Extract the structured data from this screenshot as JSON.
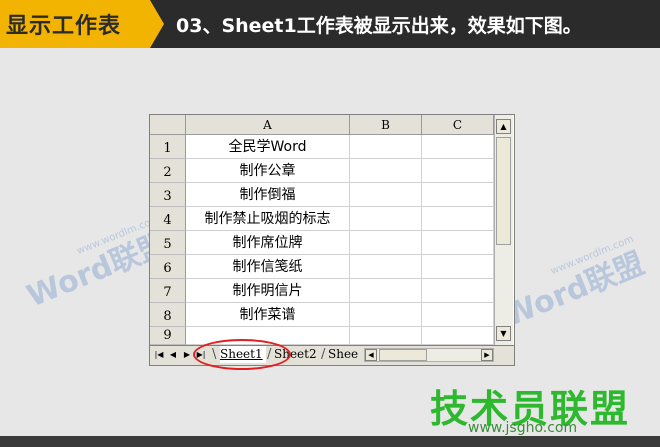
{
  "banner": {
    "badge": "显示工作表",
    "title": "03、Sheet1工作表被显示出来，效果如下图。",
    "badge_color": "#f2b400",
    "bg_color": "#2b2b2b"
  },
  "sheet": {
    "columns": [
      "A",
      "B",
      "C"
    ],
    "rows": [
      {
        "num": "1",
        "a": "全民学Word"
      },
      {
        "num": "2",
        "a": "制作公章"
      },
      {
        "num": "3",
        "a": "制作倒福"
      },
      {
        "num": "4",
        "a": "制作禁止吸烟的标志"
      },
      {
        "num": "5",
        "a": "制作席位牌"
      },
      {
        "num": "6",
        "a": "制作信笺纸"
      },
      {
        "num": "7",
        "a": "制作明信片"
      },
      {
        "num": "8",
        "a": "制作菜谱"
      },
      {
        "num": "9",
        "a": ""
      }
    ],
    "tabs": {
      "sheet1": "Sheet1",
      "sheet2": "Sheet2",
      "sheet3": "Shee"
    },
    "nav": {
      "first": "|◀",
      "prev": "◀",
      "next": "▶",
      "last": "▶|"
    }
  },
  "highlight_color": "#e02020",
  "watermark": {
    "left": "Word联盟",
    "left_small": "www.wordlm.com",
    "right": "Word联盟",
    "right_small": "www.wordlm.com"
  },
  "logo": {
    "name": "技术员联盟",
    "url": "www.jsgho.com",
    "color": "#2db82d"
  }
}
